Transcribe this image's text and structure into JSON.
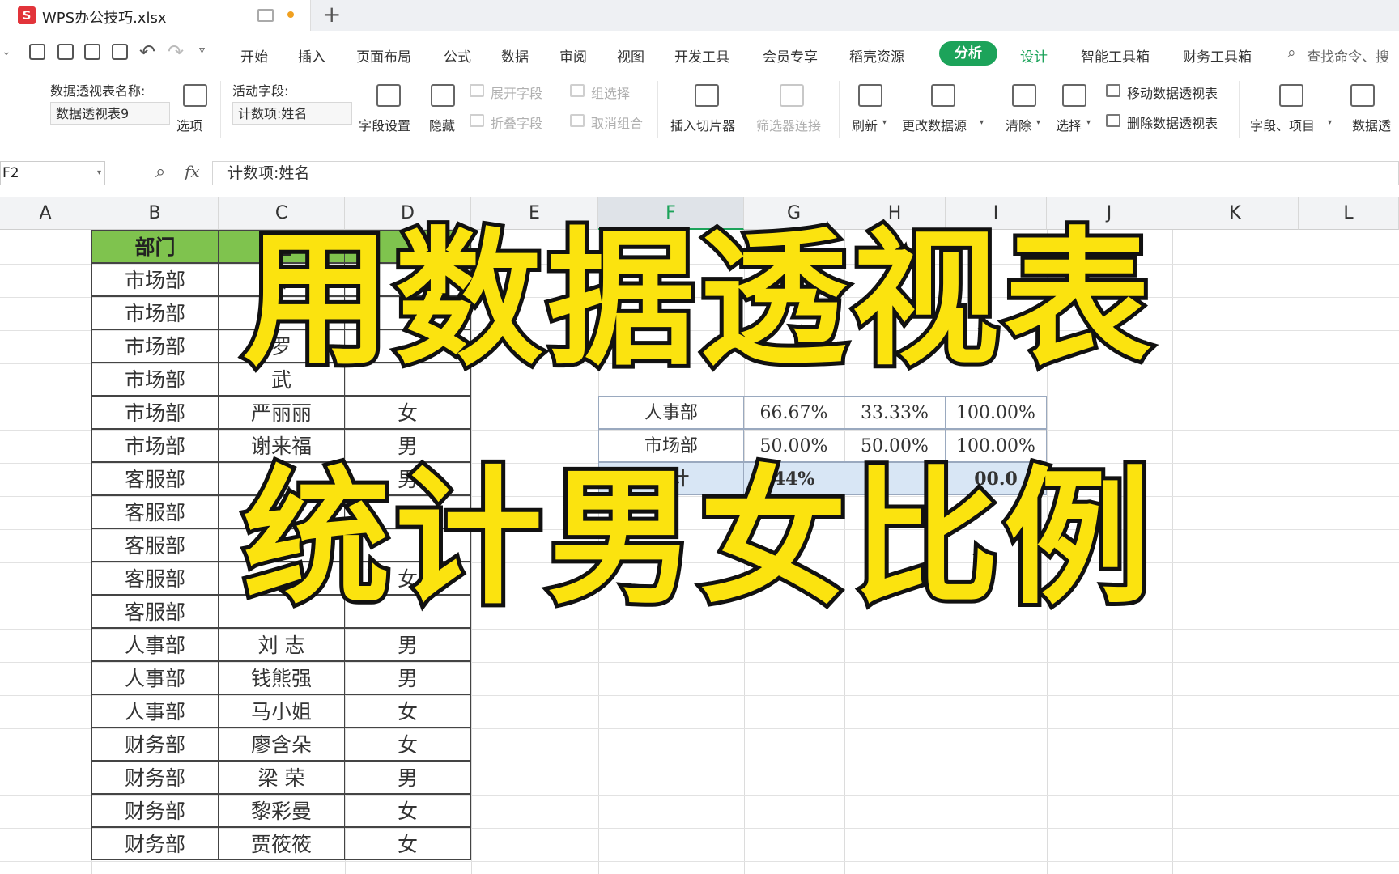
{
  "app": {
    "file_name": "WPS办公技巧.xlsx",
    "logo_letter": "S"
  },
  "menu": {
    "items": [
      "开始",
      "插入",
      "页面布局",
      "公式",
      "数据",
      "审阅",
      "视图",
      "开发工具",
      "会员专享",
      "稻壳资源"
    ],
    "active": "分析",
    "design": "设计",
    "extra": [
      "智能工具箱",
      "财务工具箱"
    ],
    "search": "查找命令、搜"
  },
  "ribbon": {
    "pivot_name_label": "数据透视表名称:",
    "pivot_name_value": "数据透视表9",
    "options": "选项",
    "active_field_label": "活动字段:",
    "active_field_value": "计数项:姓名",
    "field_settings": "字段设置",
    "hide": "隐藏",
    "expand_field": "展开字段",
    "collapse_field": "折叠字段",
    "group_select": "组选择",
    "ungroup": "取消组合",
    "insert_slicer": "插入切片器",
    "filter_connection": "筛选器连接",
    "refresh": "刷新",
    "change_source": "更改数据源",
    "clear": "清除",
    "select": "选择",
    "move_pivot": "移动数据透视表",
    "delete_pivot": "删除数据透视表",
    "fields_items": "字段、项目",
    "pivot_chart": "数据透"
  },
  "formula_bar": {
    "cell_ref": "F2",
    "fx": "fx",
    "content": "计数项:姓名"
  },
  "columns": [
    "A",
    "B",
    "C",
    "D",
    "E",
    "F",
    "G",
    "H",
    "I",
    "J",
    "K",
    "L"
  ],
  "table": {
    "header": [
      "部门",
      "姓"
    ],
    "rows": [
      [
        "市场部",
        "叶",
        ""
      ],
      [
        "市场部",
        "孙",
        ""
      ],
      [
        "市场部",
        "罗",
        ""
      ],
      [
        "市场部",
        "武",
        ""
      ],
      [
        "市场部",
        "严丽丽",
        "女"
      ],
      [
        "市场部",
        "谢来福",
        "男"
      ],
      [
        "客服部",
        "黄",
        "男"
      ],
      [
        "客服部",
        "",
        ""
      ],
      [
        "客服部",
        "",
        ""
      ],
      [
        "客服部",
        "",
        "女"
      ],
      [
        "客服部",
        "",
        ""
      ],
      [
        "人事部",
        "刘   志",
        "男"
      ],
      [
        "人事部",
        "钱熊强",
        "男"
      ],
      [
        "人事部",
        "马小姐",
        "女"
      ],
      [
        "财务部",
        "廖含朵",
        "女"
      ],
      [
        "财务部",
        "梁   荣",
        "男"
      ],
      [
        "财务部",
        "黎彩曼",
        "女"
      ],
      [
        "财务部",
        "贾筱筱",
        "女"
      ]
    ]
  },
  "pivot": {
    "rows": [
      [
        "人事部",
        "66.67%",
        "33.33%",
        "100.00%"
      ],
      [
        "市场部",
        "50.00%",
        "50.00%",
        "100.00%"
      ]
    ],
    "total": [
      "总计",
      "44%",
      "",
      "00.0"
    ]
  },
  "overlay": {
    "line1": "用数据透视表",
    "line2": "统计男女比例"
  }
}
